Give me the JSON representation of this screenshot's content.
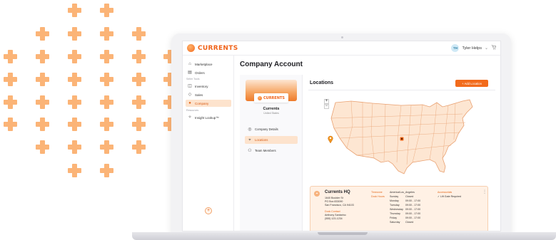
{
  "app": {
    "logo_text": "CURRENTS",
    "brand_color": "#f26b1c"
  },
  "topbar": {
    "user_initials": "TH",
    "user_name": "Tyler Helps",
    "chevron_icon": "chevron-down-icon",
    "cart_icon": "cart-icon"
  },
  "sidebar": {
    "items": [
      {
        "label": "Marketplace",
        "icon": "home-icon"
      },
      {
        "label": "Orders",
        "icon": "clipboard-icon"
      }
    ],
    "section_seller": "Seller Tools",
    "seller_items": [
      {
        "label": "Inventory",
        "icon": "box-icon"
      },
      {
        "label": "Sales",
        "icon": "tag-icon"
      },
      {
        "label": "Company",
        "icon": "building-icon",
        "active": true
      }
    ],
    "section_resources": "Resources",
    "resource_items": [
      {
        "label": "Insight Lookup™",
        "icon": "lightbulb-icon"
      }
    ],
    "fab_symbol": "+"
  },
  "main": {
    "page_title": "Company Account",
    "profile": {
      "logo_text": "CURRENTS",
      "name": "Currents",
      "country": "United States",
      "menu": [
        {
          "label": "Company Details",
          "icon": "globe-icon"
        },
        {
          "label": "Locations",
          "icon": "location-icon",
          "active": true
        },
        {
          "label": "Team Members",
          "icon": "users-icon"
        }
      ]
    },
    "locations": {
      "title": "Locations",
      "add_button": "+ Add Location",
      "zoom_in": "+",
      "zoom_out": "−",
      "hq": {
        "name": "Currents HQ",
        "address_1": "1640 Boulder St",
        "address_2": "PO Box 833090",
        "address_3": "San Francisco, CA 94103",
        "contact_label": "Dock Contact",
        "contact_name": "Anthony Santarino",
        "contact_phone": "(555) 123-1234",
        "timezone_label": "Timezone",
        "timezone_value": "America/Los_Angeles",
        "dock_hours_label": "Dock Hours",
        "hours": [
          {
            "day": "Sunday",
            "time": "Closed"
          },
          {
            "day": "Monday",
            "time": "09:00 - 17:00"
          },
          {
            "day": "Tuesday",
            "time": "09:00 - 17:00"
          },
          {
            "day": "Wednesday",
            "time": "09:00 - 17:00"
          },
          {
            "day": "Thursday",
            "time": "09:00 - 17:00"
          },
          {
            "day": "Friday",
            "time": "09:00 - 17:00"
          },
          {
            "day": "Saturday",
            "time": "Closed"
          }
        ],
        "accessorials_label": "Accessorials",
        "accessorial_item": "✓  Lift Gate Required",
        "more_icon": "⋮"
      }
    }
  }
}
